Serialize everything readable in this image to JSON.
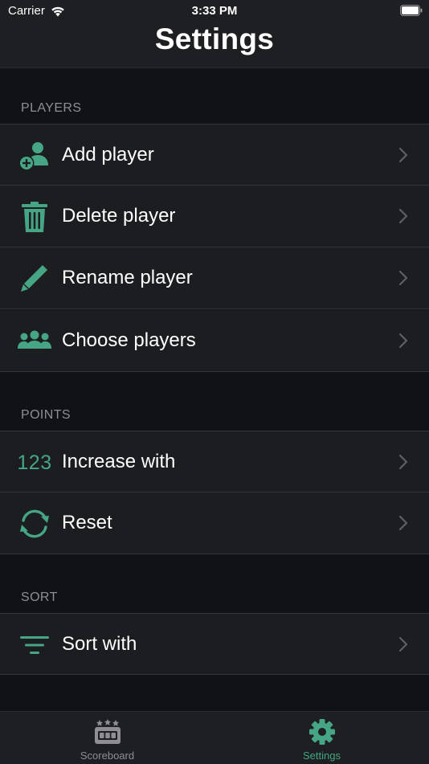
{
  "status_bar": {
    "carrier": "Carrier",
    "time": "3:33 PM"
  },
  "header": {
    "title": "Settings"
  },
  "sections": [
    {
      "header": "PLAYERS",
      "rows": [
        {
          "label": "Add player",
          "icon": "add-person-icon"
        },
        {
          "label": "Delete player",
          "icon": "trash-icon"
        },
        {
          "label": "Rename player",
          "icon": "pencil-icon"
        },
        {
          "label": "Choose players",
          "icon": "group-icon"
        }
      ]
    },
    {
      "header": "POINTS",
      "rows": [
        {
          "label": "Increase with",
          "icon": "numbers-icon",
          "icon_text": "123"
        },
        {
          "label": "Reset",
          "icon": "refresh-icon"
        }
      ]
    },
    {
      "header": "SORT",
      "rows": [
        {
          "label": "Sort with",
          "icon": "filter-lines-icon"
        }
      ]
    }
  ],
  "tab_bar": {
    "tabs": [
      {
        "label": "Scoreboard",
        "icon": "scoreboard-icon",
        "selected": false
      },
      {
        "label": "Settings",
        "icon": "gear-icon",
        "selected": true
      }
    ]
  },
  "colors": {
    "accent": "#45a584",
    "background": "#101216",
    "row_background": "#1b1d21",
    "header_background": "#1d1f23",
    "section_text": "#8e8e93",
    "tab_inactive": "#8e8e93",
    "chevron": "#5e6066"
  }
}
